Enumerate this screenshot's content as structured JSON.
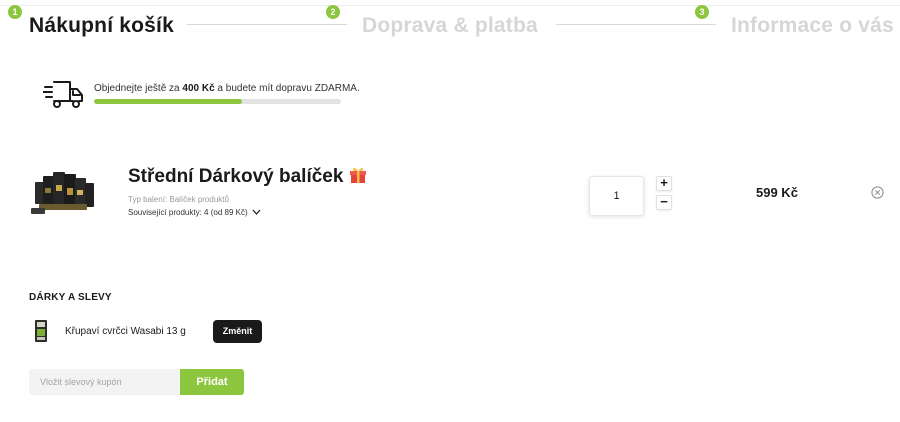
{
  "steps": [
    {
      "number": "1",
      "label": "Nákupní košík",
      "state": "active"
    },
    {
      "number": "2",
      "label": "Doprava & platba",
      "state": "inactive"
    },
    {
      "number": "3",
      "label": "Informace o vás",
      "state": "inactive"
    }
  ],
  "shipping": {
    "text_before": "Objednejte ještě za ",
    "amount": "400 Kč",
    "text_middle": " a budete mít dopravu ",
    "highlight": "ZDARMA",
    "text_after": ".",
    "progress": 0.6,
    "icon": "delivery-truck-icon"
  },
  "cart_item": {
    "name": "Střední Dárkový balíček",
    "name_icon": "gift-icon",
    "packaging": "Typ balení: Balíček produktů",
    "related_products": "Související produkty: 4 (od 89 Kč)",
    "quantity": "1",
    "plus_label": "+",
    "minus_label": "−",
    "price": "599 Kč"
  },
  "gifts": {
    "title": "DÁRKY A SLEVY",
    "item_name": "Křupaví cvrčci Wasabi 13 g",
    "change_label": "Změnit"
  },
  "coupon": {
    "placeholder": "Vložit slevový kupón",
    "value": "",
    "button_label": "Přidat"
  },
  "colors": {
    "accent": "#8cc63f",
    "dark": "#1a1a1a",
    "inactive_step": "#d6d6d6"
  }
}
